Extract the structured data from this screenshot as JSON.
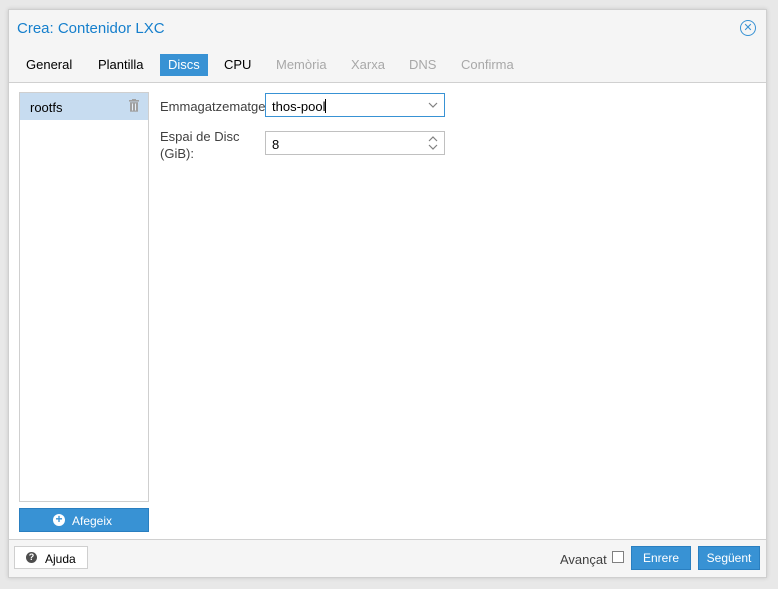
{
  "window": {
    "title": "Crea: Contenidor LXC"
  },
  "tabs": [
    {
      "label": "General",
      "state": "enabled"
    },
    {
      "label": "Plantilla",
      "state": "enabled"
    },
    {
      "label": "Discs",
      "state": "active"
    },
    {
      "label": "CPU",
      "state": "enabled"
    },
    {
      "label": "Memòria",
      "state": "disabled"
    },
    {
      "label": "Xarxa",
      "state": "disabled"
    },
    {
      "label": "DNS",
      "state": "disabled"
    },
    {
      "label": "Confirma",
      "state": "disabled"
    }
  ],
  "disks": {
    "items": [
      {
        "label": "rootfs",
        "icon": "trash-icon"
      }
    ],
    "add_label": "Afegeix"
  },
  "form": {
    "storage_label": "Emmagatzematge",
    "storage_value": "thos-pool",
    "disk_size_label_line1": "Espai de Disc",
    "disk_size_label_line2": "(GiB):",
    "disk_size_value": "8"
  },
  "footer": {
    "help_label": "Ajuda",
    "advanced_label": "Avançat",
    "advanced_checked": false,
    "back_label": "Enrere",
    "next_label": "Següent"
  },
  "colors": {
    "accent": "#3892d4",
    "title": "#157fcc",
    "selected_row": "#c7dcf0",
    "disabled_text": "#a8a8a8"
  }
}
